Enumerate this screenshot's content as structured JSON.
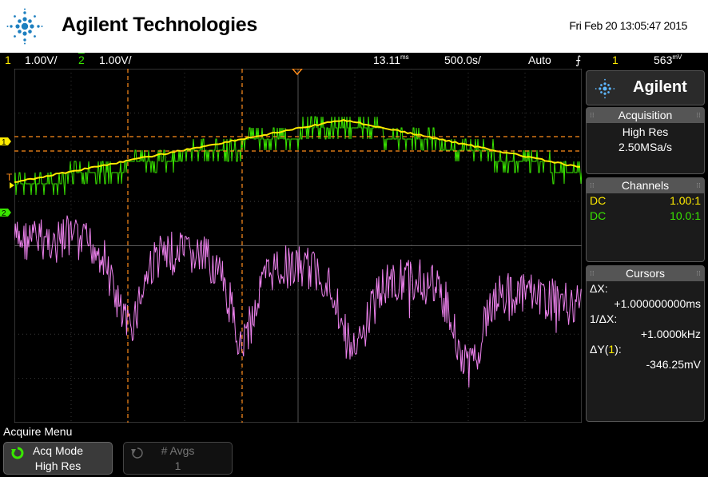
{
  "header": {
    "brand": "Agilent Technologies",
    "datetime": "Fri Feb 20 13:05:47 2015"
  },
  "status_bar": {
    "ch1_num": "1",
    "ch1_scale": "1.00V/",
    "ch2_num": "2",
    "ch2_scale": "1.00V/",
    "time_offset": "13.11",
    "time_offset_unit": "ms",
    "timebase": "500.0",
    "timebase_unit": "s/",
    "trigger_mode": "Auto",
    "trigger_source": "1",
    "trigger_level": "563",
    "trigger_level_unit": "mV"
  },
  "side_panel": {
    "brand_short": "Agilent",
    "acquisition": {
      "title": "Acquisition",
      "mode": "High Res",
      "rate": "2.50MSa/s"
    },
    "channels": {
      "title": "Channels",
      "rows": [
        {
          "coupling": "DC",
          "probe": "1.00:1",
          "color": "#ffeb00"
        },
        {
          "coupling": "DC",
          "probe": "10.0:1",
          "color": "#39e600"
        }
      ]
    },
    "cursors": {
      "title": "Cursors",
      "dx_label": "ΔX:",
      "dx_value": "+1.000000000ms",
      "inv_dx_label": "1/ΔX:",
      "inv_dx_value": "+1.0000kHz",
      "dy_label_prefix": "ΔY(",
      "dy_label_ch": "1",
      "dy_label_suffix": "):",
      "dy_value": "-346.25mV"
    }
  },
  "softkeys": {
    "menu_title": "Acquire Menu",
    "acq_mode_label": "Acq Mode",
    "acq_mode_value": "High Res",
    "avgs_label": "# Avgs",
    "avgs_value": "1"
  },
  "markers": {
    "ch1_marker": "1",
    "ch2_marker": "2",
    "trigger_marker": "T"
  },
  "colors": {
    "ch1": "#ffeb00",
    "ch2": "#39e600",
    "math": "#ee82ee",
    "cursor": "#ff8c1a",
    "grid": "#3a3a3a"
  }
}
